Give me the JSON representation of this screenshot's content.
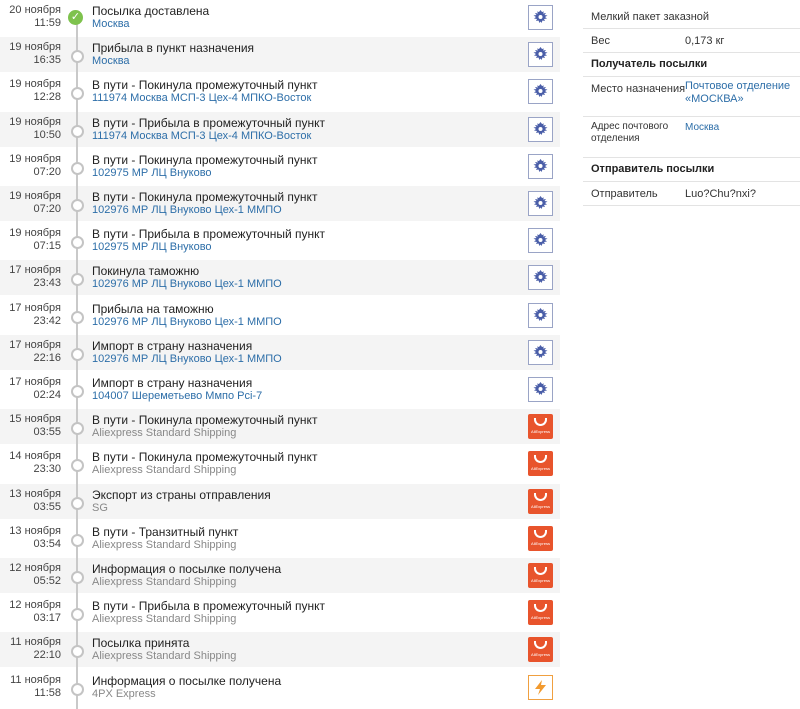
{
  "timeline": [
    {
      "date": "20 ноября",
      "time": "11:59",
      "status": "Посылка доставлена",
      "place": "Москва",
      "carrier": "pochta",
      "done": true
    },
    {
      "date": "19 ноября",
      "time": "16:35",
      "status": "Прибыла в пункт назначения",
      "place": "Москва",
      "carrier": "pochta"
    },
    {
      "date": "19 ноября",
      "time": "12:28",
      "status": "В пути - Покинула промежуточный пункт",
      "place": "111974 Москва МСП-3 Цех-4 МПКО-Восток",
      "carrier": "pochta"
    },
    {
      "date": "19 ноября",
      "time": "10:50",
      "status": "В пути - Прибыла в промежуточный пункт",
      "place": "111974 Москва МСП-3 Цех-4 МПКО-Восток",
      "carrier": "pochta"
    },
    {
      "date": "19 ноября",
      "time": "07:20",
      "status": "В пути - Покинула промежуточный пункт",
      "place": "102975 МР ЛЦ Внуково",
      "carrier": "pochta"
    },
    {
      "date": "19 ноября",
      "time": "07:20",
      "status": "В пути - Покинула промежуточный пункт",
      "place": "102976 МР ЛЦ Внуково Цех-1 ММПО",
      "carrier": "pochta"
    },
    {
      "date": "19 ноября",
      "time": "07:15",
      "status": "В пути - Прибыла в промежуточный пункт",
      "place": "102975 МР ЛЦ Внуково",
      "carrier": "pochta"
    },
    {
      "date": "17 ноября",
      "time": "23:43",
      "status": "Покинула таможню",
      "place": "102976 МР ЛЦ Внуково Цех-1 ММПО",
      "carrier": "pochta"
    },
    {
      "date": "17 ноября",
      "time": "23:42",
      "status": "Прибыла на таможню",
      "place": "102976 МР ЛЦ Внуково Цех-1 ММПО",
      "carrier": "pochta"
    },
    {
      "date": "17 ноября",
      "time": "22:16",
      "status": "Импорт в страну назначения",
      "place": "102976 МР ЛЦ Внуково Цех-1 ММПО",
      "carrier": "pochta"
    },
    {
      "date": "17 ноября",
      "time": "02:24",
      "status": "Импорт в страну назначения",
      "place": "104007 Шереметьево Ммпо Pci-7",
      "carrier": "pochta"
    },
    {
      "date": "15 ноября",
      "time": "03:55",
      "status": "В пути - Покинула промежуточный пункт",
      "place": "Aliexpress Standard Shipping",
      "carrier": "ali"
    },
    {
      "date": "14 ноября",
      "time": "23:30",
      "status": "В пути - Покинула промежуточный пункт",
      "place": "Aliexpress Standard Shipping",
      "carrier": "ali"
    },
    {
      "date": "13 ноября",
      "time": "03:55",
      "status": "Экспорт из страны отправления",
      "place": "SG",
      "carrier": "ali"
    },
    {
      "date": "13 ноября",
      "time": "03:54",
      "status": "В пути - Транзитный пункт",
      "place": "Aliexpress Standard Shipping",
      "carrier": "ali"
    },
    {
      "date": "12 ноября",
      "time": "05:52",
      "status": "Информация о посылке получена",
      "place": "Aliexpress Standard Shipping",
      "carrier": "ali"
    },
    {
      "date": "12 ноября",
      "time": "03:17",
      "status": "В пути - Прибыла в промежуточный пункт",
      "place": "Aliexpress Standard Shipping",
      "carrier": "ali"
    },
    {
      "date": "11 ноября",
      "time": "22:10",
      "status": "Посылка принята",
      "place": "Aliexpress Standard Shipping",
      "carrier": "ali"
    },
    {
      "date": "11 ноября",
      "time": "11:58",
      "status": "Информация о посылке получена",
      "place": "4PX Express",
      "carrier": "4px"
    }
  ],
  "logos": {
    "ali_text": "AliExpress"
  },
  "info": {
    "package_type": "Мелкий пакет заказной",
    "weight_label": "Вес",
    "weight_value": "0,173 кг",
    "recipient_header": "Получатель посылки",
    "destination_label": "Место назначения",
    "destination_value": "Почтовое отделение «МОСКВА»",
    "address_label": "Адрес почтового отделения",
    "address_value": "Москва",
    "sender_header": "Отправитель посылки",
    "sender_label": "Отправитель",
    "sender_value": "Luo?Chu?nxi?"
  },
  "colors": {
    "link": "#2d6ea8",
    "muted": "#888888",
    "done": "#7ec24d",
    "aliexpress": "#e8542c",
    "pochta_border": "#9aa4c6"
  }
}
